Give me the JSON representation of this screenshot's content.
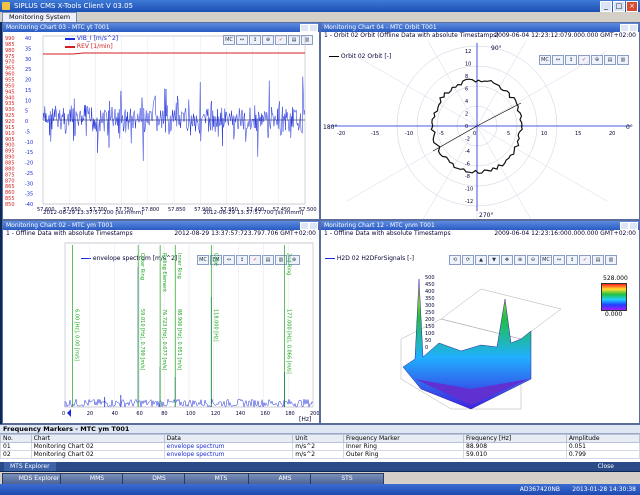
{
  "app": {
    "title": "SIPLUS CMS X-Tools Client V 03.05"
  },
  "tabs": [
    {
      "label": "Monitoring System"
    }
  ],
  "panels": {
    "chart03": {
      "title": "Monitoring Chart 03 - MTC yt T001",
      "legend": [
        "VIB_I [m/s^2]",
        "REV [1/min]"
      ],
      "left_axis": [
        "990",
        "985",
        "980",
        "975",
        "970",
        "965",
        "960",
        "955",
        "950",
        "945",
        "940",
        "935",
        "930",
        "925",
        "920",
        "915",
        "910",
        "905",
        "900",
        "895",
        "890",
        "885",
        "880",
        "875",
        "870",
        "865",
        "860",
        "855",
        "850"
      ],
      "right_axis": [
        "40",
        "35",
        "30",
        "25",
        "20",
        "15",
        "10",
        "5",
        "0",
        "-5",
        "-10",
        "-15",
        "-20",
        "-25",
        "-30",
        "-35",
        "-40"
      ],
      "x_ticks": [
        "57.600",
        "57.650",
        "57.700",
        "57.750",
        "57.800",
        "57.850",
        "57.900",
        "57.950",
        "57.400",
        "57.450",
        "57.500"
      ],
      "footer_left": "2012-08-29 13:37:57.200 [ss.mmm]",
      "footer_right": "2012-08-29 13:37:57.700 [ss.mmm]"
    },
    "chart04": {
      "title": "Monitoring Chart 04 - MTC Orbit T001",
      "subheader": "1 - Orbit 02 Orbit (Offline Data with absolute Timestamps)",
      "timestamp": "2009-06-04 12:23:12:079.000.000 GMT+02:00",
      "legend": "Orbit 02 Orbit [-]",
      "y_ticks": [
        "12",
        "10",
        "8",
        "6",
        "4",
        "2",
        "0",
        "-2",
        "-4",
        "-6",
        "-8",
        "-10",
        "-12"
      ],
      "x_ticks": [
        "-20",
        "-15",
        "-10",
        "-5",
        "0",
        "5",
        "10",
        "15",
        "20"
      ],
      "angles": [
        "90°",
        "180°",
        "0°",
        "270°"
      ]
    },
    "chart02": {
      "title": "Monitoring Chart 02 - MTC ym T001",
      "subheader": "1 - Offline Data with absolute Timestamps",
      "timestamp": "2012-08-29 13:37:57:723.797.706 GMT+02:00",
      "legend": "envelope spectrum [m/s^2]",
      "markers": [
        "6.00 [Hz], 0.00 [m/s]",
        "59.010 [Hz], 0.799 [m/s]",
        "76.723 [Hz], 0.077 [m/s]",
        "88.906 [Hz], 0.051 [m/s]",
        "118.000 [Hz]",
        "177.000 [Hz], 0.066 [m/s]"
      ],
      "marker_names": [
        "Outer Ring",
        "Rolling Element",
        "Inner Ring",
        "Cage",
        "2nd Ring"
      ],
      "x_ticks": [
        "0",
        "20",
        "40",
        "60",
        "80",
        "100",
        "120",
        "140",
        "160",
        "180",
        "200"
      ],
      "x_unit": "[Hz]"
    },
    "chart12": {
      "title": "Monitoring Chart 12 - MTC ynm T001",
      "subheader": "1 - Offline Data with absolute Timestamps",
      "timestamp": "2009-06-04 12:23:16:000.000.000 GMT+02:00",
      "legend": "H2D 02 H2DForSignals [-]",
      "colorbar": [
        "528.000",
        "0.000"
      ],
      "z_ticks": [
        "500",
        "450",
        "400",
        "350",
        "300",
        "250",
        "200",
        "150",
        "100",
        "50",
        "0"
      ]
    }
  },
  "frequency_markers": {
    "title": "Frequency Markers - MTC ym T001",
    "columns": [
      "No.",
      "Chart",
      "Data",
      "Unit",
      "Frequency Marker",
      "Frequency [Hz]",
      "Amplitude"
    ],
    "rows": [
      [
        "01",
        "Monitoring Chart 02",
        "envelope spectrum",
        "m/s^2",
        "Inner Ring",
        "88.908",
        "0.051"
      ],
      [
        "02",
        "Monitoring Chart 02",
        "envelope spectrum",
        "m/s^2",
        "Outer Ring",
        "59.010",
        "0.799"
      ]
    ]
  },
  "explorer_tab": "MTS Explorer",
  "close_label": "Close",
  "modes": [
    "MDS Explorer",
    "MMS",
    "DMS",
    "MTS",
    "AMS",
    "STS"
  ],
  "status": {
    "host": "AD367420NB",
    "datetime": "2013-01-28 14:30:38"
  },
  "colors": {
    "vib": "#1a2bd9",
    "rev": "#d41f1f",
    "marker": "#1aa31a"
  },
  "icons": {
    "save": "save-icon",
    "zoom": "zoom-icon"
  }
}
